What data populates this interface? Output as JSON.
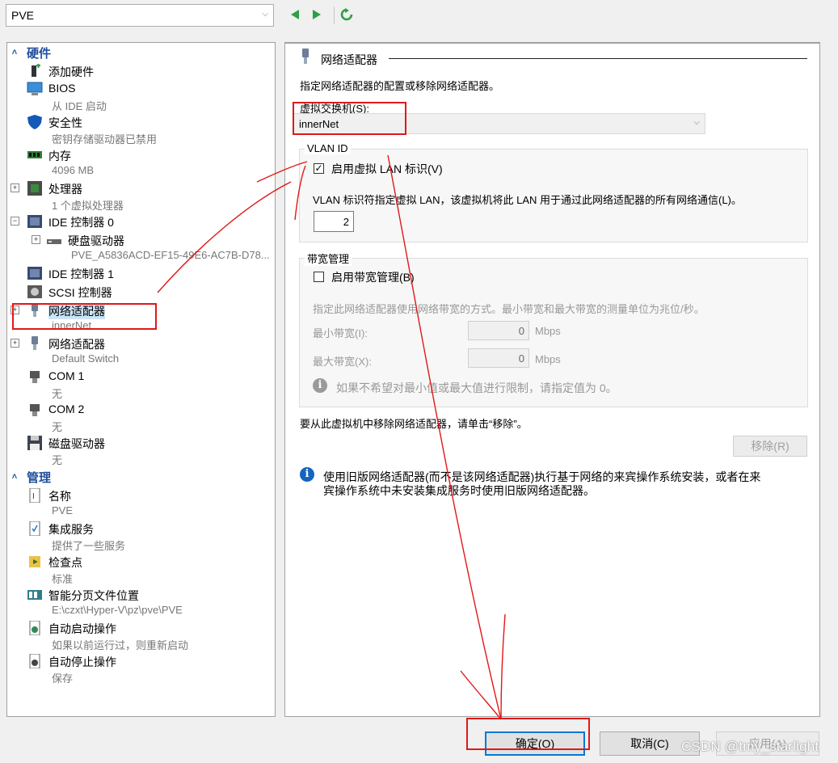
{
  "toolbar": {
    "vm_name": "PVE",
    "icons": [
      "back-arrow-icon",
      "forward-arrow-icon",
      "refresh-icon"
    ]
  },
  "left": {
    "hardware_header": "硬件",
    "management_header": "管理",
    "hardware": [
      {
        "label": "添加硬件",
        "sub": "",
        "icon": "add-hardware-icon"
      },
      {
        "label": "BIOS",
        "sub": "从 IDE 启动",
        "icon": "bios-icon"
      },
      {
        "label": "安全性",
        "sub": "密钥存储驱动器已禁用",
        "icon": "shield-icon"
      },
      {
        "label": "内存",
        "sub": "4096 MB",
        "icon": "memory-icon"
      },
      {
        "label": "处理器",
        "sub": "1 个虚拟处理器",
        "icon": "cpu-icon"
      },
      {
        "label": "IDE 控制器 0",
        "sub": "",
        "icon": "ide-controller-icon"
      },
      {
        "label": "硬盘驱动器",
        "sub": "PVE_A5836ACD-EF15-49E6-AC7B-D78...",
        "icon": "hard-drive-icon"
      },
      {
        "label": "IDE 控制器 1",
        "sub": "",
        "icon": "ide-controller-icon"
      },
      {
        "label": "SCSI 控制器",
        "sub": "",
        "icon": "scsi-controller-icon"
      },
      {
        "label": "网络适配器",
        "sub": "innerNet",
        "icon": "network-adapter-icon"
      },
      {
        "label": "网络适配器",
        "sub": "Default Switch",
        "icon": "network-adapter-icon"
      },
      {
        "label": "COM 1",
        "sub": "无",
        "icon": "com-port-icon"
      },
      {
        "label": "COM 2",
        "sub": "无",
        "icon": "com-port-icon"
      },
      {
        "label": "磁盘驱动器",
        "sub": "无",
        "icon": "floppy-icon"
      }
    ],
    "management": [
      {
        "label": "名称",
        "sub": "PVE",
        "icon": "name-icon"
      },
      {
        "label": "集成服务",
        "sub": "提供了一些服务",
        "icon": "integration-services-icon"
      },
      {
        "label": "检查点",
        "sub": "标准",
        "icon": "checkpoint-icon"
      },
      {
        "label": "智能分页文件位置",
        "sub": "E:\\czxt\\Hyper-V\\pz\\pve\\PVE",
        "icon": "smart-paging-icon"
      },
      {
        "label": "自动启动操作",
        "sub": "如果以前运行过，则重新启动",
        "icon": "auto-start-icon"
      },
      {
        "label": "自动停止操作",
        "sub": "保存",
        "icon": "auto-stop-icon"
      }
    ]
  },
  "right": {
    "title": "网络适配器",
    "description": "指定网络适配器的配置或移除网络适配器。",
    "switch_label": "虚拟交换机(S):",
    "switch_value": "innerNet",
    "vlan": {
      "group_title": "VLAN ID",
      "checkbox_label": "启用虚拟 LAN 标识(V)",
      "checked": true,
      "description": "VLAN 标识符指定虚拟 LAN，该虚拟机将此 LAN 用于通过此网络适配器的所有网络通信(L)。",
      "value": "2"
    },
    "bandwidth": {
      "group_title": "带宽管理",
      "checkbox_label": "启用带宽管理(B)",
      "checked": false,
      "description": "指定此网络适配器使用网络带宽的方式。最小带宽和最大带宽的测量单位为兆位/秒。",
      "min_label": "最小带宽(I):",
      "min_value": "0",
      "max_label": "最大带宽(X):",
      "max_value": "0",
      "unit": "Mbps",
      "note": "如果不希望对最小值或最大值进行限制，请指定值为 0。"
    },
    "remove_text": "要从此虚拟机中移除网络适配器，请单击“移除”。",
    "remove_button": "移除(R)",
    "legacy_info_1": "使用旧版网络适配器(而不是该网络适配器)执行基于网络的来宾操作系统安装，或者在来",
    "legacy_info_2": "宾操作系统中未安装集成服务时使用旧版网络适配器。"
  },
  "buttons": {
    "ok": "确定(O)",
    "cancel": "取消(C)",
    "apply": "应用(A)"
  },
  "watermark": "CSDN @tmy_starlight",
  "colors": {
    "accent": "#0078d7",
    "section_header": "#1f4e9c",
    "annotation": "#e01818",
    "info": "#1565c0"
  }
}
